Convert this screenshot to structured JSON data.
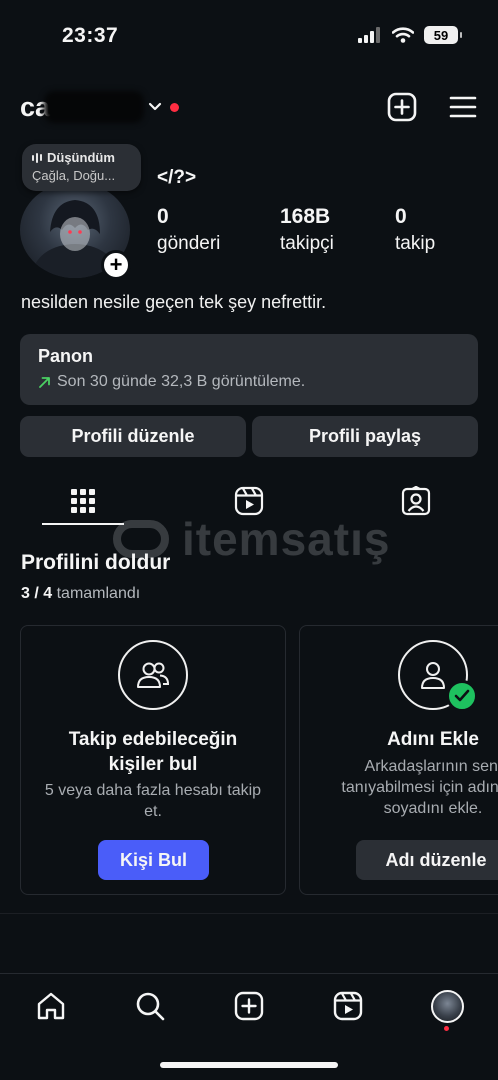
{
  "status_bar": {
    "time": "23:37",
    "battery": "59"
  },
  "header": {
    "username_visible": "ca"
  },
  "note": {
    "title": "Düşündüm",
    "subtitle": "Çağla, Doğu..."
  },
  "profile": {
    "display_name": "</?>",
    "stats": [
      {
        "value": "0",
        "label": "gönderi"
      },
      {
        "value": "168B",
        "label": "takipçi"
      },
      {
        "value": "0",
        "label": "takip"
      }
    ],
    "bio": "nesilden nesile geçen tek şey nefrettir."
  },
  "panon": {
    "title": "Panon",
    "subtitle": "Son 30 günde 32,3 B görüntüleme."
  },
  "buttons": {
    "edit_profile": "Profili düzenle",
    "share_profile": "Profili paylaş"
  },
  "watermark": "itemsatış",
  "profile_completion": {
    "title": "Profilini doldur",
    "done": "3 / 4",
    "done_suffix": "tamamlandı",
    "cards": [
      {
        "title": "Takip edebileceğin kişiler bul",
        "description": "5 veya daha fazla hesabı takip et.",
        "button": "Kişi Bul"
      },
      {
        "title": "Adını Ekle",
        "description": "Arkadaşlarının seni tanıyabilmesi için adını ve soyadını ekle.",
        "button": "Adı düzenle"
      }
    ]
  },
  "colors": {
    "background": "#0c1014",
    "surface": "#2b2f35",
    "accent_button": "#4a5df9",
    "check_green": "#1ec15f",
    "notification_red": "#ff2d42"
  }
}
